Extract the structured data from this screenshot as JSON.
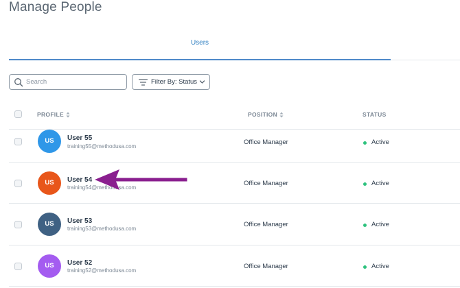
{
  "page": {
    "title": "Manage People"
  },
  "tabs": [
    {
      "label": "Users",
      "active": true
    }
  ],
  "search": {
    "placeholder": "Search",
    "value": ""
  },
  "filter": {
    "label": "Filter By: Status"
  },
  "table": {
    "columns": {
      "profile": "PROFILE",
      "position": "POSITION",
      "status": "STATUS"
    },
    "rows": [
      {
        "initials": "US",
        "name": "User 55",
        "email": "training55@methodusa.com",
        "position": "Office Manager",
        "status": "Active",
        "avatar_color": "#2f97e8"
      },
      {
        "initials": "US",
        "name": "User 54",
        "email": "training54@methodusa.com",
        "position": "Office Manager",
        "status": "Active",
        "avatar_color": "#e8561a"
      },
      {
        "initials": "US",
        "name": "User 53",
        "email": "training53@methodusa.com",
        "position": "Office Manager",
        "status": "Active",
        "avatar_color": "#3f6183"
      },
      {
        "initials": "US",
        "name": "User 52",
        "email": "training52@methodusa.com",
        "position": "Office Manager",
        "status": "Active",
        "avatar_color": "#a45cf0"
      }
    ]
  },
  "colors": {
    "accent": "#4f8ac9",
    "status_active": "#2ec27e",
    "annotation_arrow": "#8a1f8f"
  },
  "icons": {
    "search": "search-icon",
    "filter": "filter-icon",
    "chevron": "chevron-down-icon",
    "sort": "sort-icon"
  }
}
